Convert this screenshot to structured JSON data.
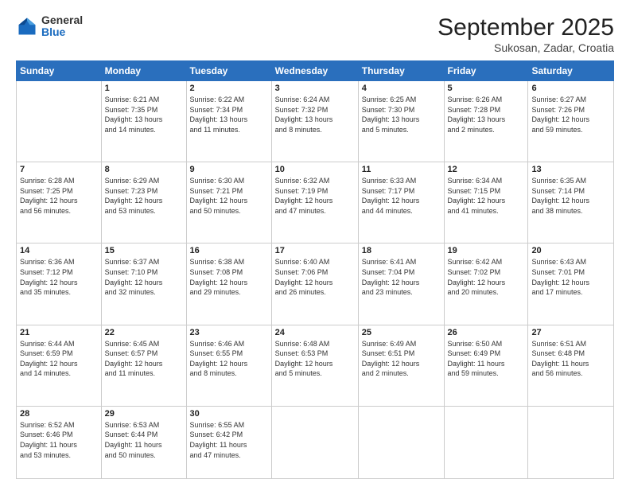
{
  "header": {
    "logo": {
      "general": "General",
      "blue": "Blue"
    },
    "title": "September 2025",
    "location": "Sukosan, Zadar, Croatia"
  },
  "days_of_week": [
    "Sunday",
    "Monday",
    "Tuesday",
    "Wednesday",
    "Thursday",
    "Friday",
    "Saturday"
  ],
  "weeks": [
    [
      {
        "day": "",
        "info": ""
      },
      {
        "day": "1",
        "info": "Sunrise: 6:21 AM\nSunset: 7:35 PM\nDaylight: 13 hours\nand 14 minutes."
      },
      {
        "day": "2",
        "info": "Sunrise: 6:22 AM\nSunset: 7:34 PM\nDaylight: 13 hours\nand 11 minutes."
      },
      {
        "day": "3",
        "info": "Sunrise: 6:24 AM\nSunset: 7:32 PM\nDaylight: 13 hours\nand 8 minutes."
      },
      {
        "day": "4",
        "info": "Sunrise: 6:25 AM\nSunset: 7:30 PM\nDaylight: 13 hours\nand 5 minutes."
      },
      {
        "day": "5",
        "info": "Sunrise: 6:26 AM\nSunset: 7:28 PM\nDaylight: 13 hours\nand 2 minutes."
      },
      {
        "day": "6",
        "info": "Sunrise: 6:27 AM\nSunset: 7:26 PM\nDaylight: 12 hours\nand 59 minutes."
      }
    ],
    [
      {
        "day": "7",
        "info": "Sunrise: 6:28 AM\nSunset: 7:25 PM\nDaylight: 12 hours\nand 56 minutes."
      },
      {
        "day": "8",
        "info": "Sunrise: 6:29 AM\nSunset: 7:23 PM\nDaylight: 12 hours\nand 53 minutes."
      },
      {
        "day": "9",
        "info": "Sunrise: 6:30 AM\nSunset: 7:21 PM\nDaylight: 12 hours\nand 50 minutes."
      },
      {
        "day": "10",
        "info": "Sunrise: 6:32 AM\nSunset: 7:19 PM\nDaylight: 12 hours\nand 47 minutes."
      },
      {
        "day": "11",
        "info": "Sunrise: 6:33 AM\nSunset: 7:17 PM\nDaylight: 12 hours\nand 44 minutes."
      },
      {
        "day": "12",
        "info": "Sunrise: 6:34 AM\nSunset: 7:15 PM\nDaylight: 12 hours\nand 41 minutes."
      },
      {
        "day": "13",
        "info": "Sunrise: 6:35 AM\nSunset: 7:14 PM\nDaylight: 12 hours\nand 38 minutes."
      }
    ],
    [
      {
        "day": "14",
        "info": "Sunrise: 6:36 AM\nSunset: 7:12 PM\nDaylight: 12 hours\nand 35 minutes."
      },
      {
        "day": "15",
        "info": "Sunrise: 6:37 AM\nSunset: 7:10 PM\nDaylight: 12 hours\nand 32 minutes."
      },
      {
        "day": "16",
        "info": "Sunrise: 6:38 AM\nSunset: 7:08 PM\nDaylight: 12 hours\nand 29 minutes."
      },
      {
        "day": "17",
        "info": "Sunrise: 6:40 AM\nSunset: 7:06 PM\nDaylight: 12 hours\nand 26 minutes."
      },
      {
        "day": "18",
        "info": "Sunrise: 6:41 AM\nSunset: 7:04 PM\nDaylight: 12 hours\nand 23 minutes."
      },
      {
        "day": "19",
        "info": "Sunrise: 6:42 AM\nSunset: 7:02 PM\nDaylight: 12 hours\nand 20 minutes."
      },
      {
        "day": "20",
        "info": "Sunrise: 6:43 AM\nSunset: 7:01 PM\nDaylight: 12 hours\nand 17 minutes."
      }
    ],
    [
      {
        "day": "21",
        "info": "Sunrise: 6:44 AM\nSunset: 6:59 PM\nDaylight: 12 hours\nand 14 minutes."
      },
      {
        "day": "22",
        "info": "Sunrise: 6:45 AM\nSunset: 6:57 PM\nDaylight: 12 hours\nand 11 minutes."
      },
      {
        "day": "23",
        "info": "Sunrise: 6:46 AM\nSunset: 6:55 PM\nDaylight: 12 hours\nand 8 minutes."
      },
      {
        "day": "24",
        "info": "Sunrise: 6:48 AM\nSunset: 6:53 PM\nDaylight: 12 hours\nand 5 minutes."
      },
      {
        "day": "25",
        "info": "Sunrise: 6:49 AM\nSunset: 6:51 PM\nDaylight: 12 hours\nand 2 minutes."
      },
      {
        "day": "26",
        "info": "Sunrise: 6:50 AM\nSunset: 6:49 PM\nDaylight: 11 hours\nand 59 minutes."
      },
      {
        "day": "27",
        "info": "Sunrise: 6:51 AM\nSunset: 6:48 PM\nDaylight: 11 hours\nand 56 minutes."
      }
    ],
    [
      {
        "day": "28",
        "info": "Sunrise: 6:52 AM\nSunset: 6:46 PM\nDaylight: 11 hours\nand 53 minutes."
      },
      {
        "day": "29",
        "info": "Sunrise: 6:53 AM\nSunset: 6:44 PM\nDaylight: 11 hours\nand 50 minutes."
      },
      {
        "day": "30",
        "info": "Sunrise: 6:55 AM\nSunset: 6:42 PM\nDaylight: 11 hours\nand 47 minutes."
      },
      {
        "day": "",
        "info": ""
      },
      {
        "day": "",
        "info": ""
      },
      {
        "day": "",
        "info": ""
      },
      {
        "day": "",
        "info": ""
      }
    ]
  ]
}
